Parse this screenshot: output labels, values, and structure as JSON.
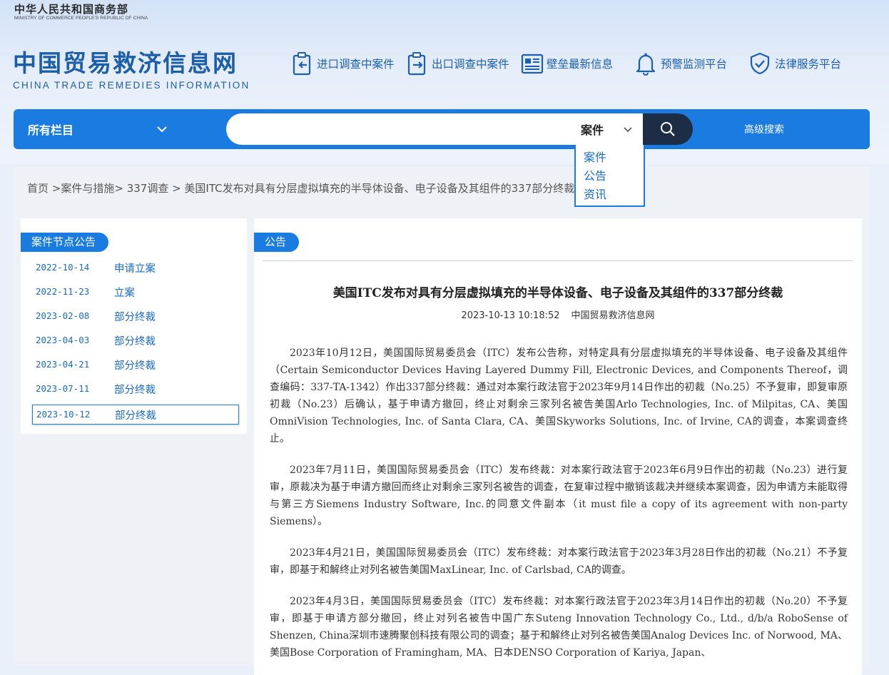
{
  "header": {
    "ministry_cn": "中华人民共和国商务部",
    "ministry_en": "MINISTRY OF COMMERCE PEOPLE'S REPUBLIC OF CHINA",
    "site_cn": "中国贸易救济信息网",
    "site_en": "CHINA TRADE REMEDIES INFORMATION",
    "nav": [
      {
        "label": "进口调查中案件",
        "icon": "import-clipboard-icon"
      },
      {
        "label": "出口调查中案件",
        "icon": "export-clipboard-icon"
      },
      {
        "label": "壁垒最新信息",
        "icon": "newspaper-icon"
      },
      {
        "label": "预警监测平台",
        "icon": "bell-icon"
      },
      {
        "label": "法律服务平台",
        "icon": "shield-check-icon"
      }
    ]
  },
  "search": {
    "category": "所有栏目",
    "type_selected": "案件",
    "placeholder": "",
    "advanced": "高级搜索",
    "options": [
      "案件",
      "公告",
      "资讯"
    ]
  },
  "breadcrumb": {
    "home": "首页",
    "level1": " >案件与措施",
    "level2": "> 337调查",
    "level3": " > 美国ITC发布对具有分层虚拟填充的半导体设备、电子设备及其组件的337部分终裁"
  },
  "sidebar": {
    "title": "案件节点公告",
    "items": [
      {
        "date": "2022-10-14",
        "label": "申请立案"
      },
      {
        "date": "2022-11-23",
        "label": "立案"
      },
      {
        "date": "2023-02-08",
        "label": "部分终裁"
      },
      {
        "date": "2023-04-03",
        "label": "部分终裁"
      },
      {
        "date": "2023-04-21",
        "label": "部分终裁"
      },
      {
        "date": "2023-07-11",
        "label": "部分终裁"
      },
      {
        "date": "2023-10-12",
        "label": "部分终裁"
      }
    ]
  },
  "article": {
    "section": "公告",
    "title": "美国ITC发布对具有分层虚拟填充的半导体设备、电子设备及其组件的337部分终裁",
    "datetime": "2023-10-13 10:18:52",
    "source": "中国贸易救济信息网",
    "paragraphs": [
      "2023年10月12日，美国国际贸易委员会（ITC）发布公告称，对特定具有分层虚拟填充的半导体设备、电子设备及其组件（Certain Semiconductor Devices Having Layered Dummy Fill, Electronic Devices, and Components Thereof，调查编码：337-TA-1342）作出337部分终裁：通过对本案行政法官于2023年9月14日作出的初裁（No.25）不予复审，即复审原初裁（No.23）后确认，基于申请方撤回，终止对剩余三家列名被告美国Arlo Technologies, Inc. of Milpitas, CA、美国OmniVision Technologies, Inc. of Santa Clara, CA、美国Skyworks Solutions, Inc. of Irvine, CA的调查，本案调查终止。",
      "2023年7月11日，美国国际贸易委员会（ITC）发布终裁：对本案行政法官于2023年6月9日作出的初裁（No.23）进行复审，原裁决为基于申请方撤回而终止对剩余三家列名被告的调查，在复审过程中撤销该裁决并继续本案调查，因为申请方未能取得与第三方Siemens Industry Software, Inc.的同意文件副本（it must file a copy of its agreement with non-party Siemens）。",
      "2023年4月21日，美国国际贸易委员会（ITC）发布终裁：对本案行政法官于2023年3月28日作出的初裁（No.21）不予复审，即基于和解终止对列名被告美国MaxLinear, Inc. of Carlsbad, CA的调查。",
      "2023年4月3日，美国国际贸易委员会（ITC）发布终裁：对本案行政法官于2023年3月14日作出的初裁（No.20）不予复审，即基于申请方部分撤回，终止对列名被告中国广东Suteng Innovation Technology Co., Ltd., d/b/a RoboSense of Shenzen, China深圳市速腾聚创科技有限公司的调查；基于和解终止对列名被告美国Analog Devices Inc. of Norwood, MA、美国Bose Corporation of Framingham, MA、日本DENSO Corporation of Kariya, Japan、"
    ]
  },
  "colors": {
    "primary": "#1a7be0",
    "search_button": "#1d2d45",
    "link": "#1a6bc4"
  }
}
